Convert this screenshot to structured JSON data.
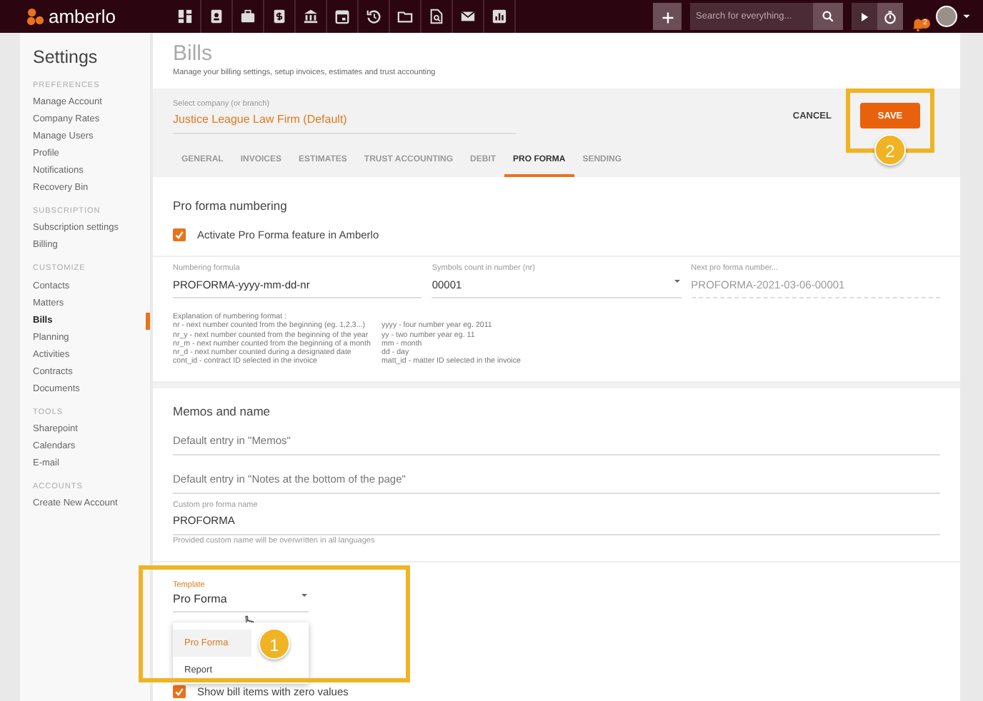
{
  "topbar": {
    "logo": "amberlo",
    "search": {
      "placeholder": "Search for everything..."
    },
    "notifications": "2"
  },
  "sidebar": {
    "title": "Settings",
    "sections": [
      {
        "heading": "PREFERENCES",
        "items": [
          {
            "label": "Manage Account",
            "selected": false
          },
          {
            "label": "Company Rates",
            "selected": false
          },
          {
            "label": "Manage Users",
            "selected": false
          },
          {
            "label": "Profile",
            "selected": false
          },
          {
            "label": "Notifications",
            "selected": false
          },
          {
            "label": "Recovery Bin",
            "selected": false
          }
        ]
      },
      {
        "heading": "SUBSCRIPTION",
        "items": [
          {
            "label": "Subscription settings",
            "selected": false
          },
          {
            "label": "Billing",
            "selected": false
          }
        ]
      },
      {
        "heading": "CUSTOMIZE",
        "items": [
          {
            "label": "Contacts",
            "selected": false
          },
          {
            "label": "Matters",
            "selected": false
          },
          {
            "label": "Bills",
            "selected": true
          },
          {
            "label": "Planning",
            "selected": false
          },
          {
            "label": "Activities",
            "selected": false
          },
          {
            "label": "Contracts",
            "selected": false
          },
          {
            "label": "Documents",
            "selected": false
          }
        ]
      },
      {
        "heading": "TOOLS",
        "items": [
          {
            "label": "Sharepoint",
            "selected": false
          },
          {
            "label": "Calendars",
            "selected": false
          },
          {
            "label": "E-mail",
            "selected": false
          }
        ]
      },
      {
        "heading": "ACCOUNTS",
        "items": [
          {
            "label": "Create New Account",
            "selected": false
          }
        ]
      }
    ]
  },
  "page": {
    "title": "Bills",
    "subtitle": "Manage your billing settings, setup invoices, estimates and trust accounting"
  },
  "company": {
    "label": "Select company (or branch)",
    "value": "Justice League Law Firm (Default)"
  },
  "actions": {
    "cancel": "CANCEL",
    "save": "SAVE"
  },
  "tabs": [
    {
      "label": "GENERAL",
      "selected": false
    },
    {
      "label": "INVOICES",
      "selected": false
    },
    {
      "label": "ESTIMATES",
      "selected": false
    },
    {
      "label": "TRUST ACCOUNTING",
      "selected": false
    },
    {
      "label": "DEBIT",
      "selected": false
    },
    {
      "label": "PRO FORMA",
      "selected": true
    },
    {
      "label": "SENDING",
      "selected": false
    }
  ],
  "numbering": {
    "title": "Pro forma numbering",
    "activate": {
      "label": "Activate Pro Forma feature in Amberlo",
      "checked": true
    },
    "fields": [
      {
        "kind": "text",
        "label": "Numbering formula",
        "value": "PROFORMA-yyyy-mm-dd-nr"
      },
      {
        "kind": "select",
        "label": "Symbols count in number (nr)",
        "value": "00001"
      },
      {
        "kind": "readonly",
        "label": "Next pro forma number...",
        "value": "PROFORMA-2021-03-06-00001"
      }
    ],
    "explanation": {
      "heading": "Explanation of numbering format :",
      "left": [
        "nr - next number counted from the beginning (eg. 1,2,3...)",
        "nr_y - next number counted from the beginning of the year",
        "nr_m - next number counted from the beginning of a month",
        "nr_d - next number counted during a designated date",
        "cont_id - contract ID selected in the invoice"
      ],
      "right": [
        "yyyy - four number year eg. 2011",
        "yy - two number year eg. 11",
        "mm - month",
        "dd - day",
        "matt_id - matter ID selected in the invoice"
      ]
    }
  },
  "memos": {
    "title": "Memos and name",
    "fields": [
      {
        "placeholder": "Default entry in \"Memos\""
      },
      {
        "placeholder": "Default entry in \"Notes at the bottom of the page\""
      }
    ],
    "custom_name": {
      "label": "Custom pro forma name",
      "value": "PROFORMA",
      "help": "Provided custom name will be overwritten in all languages"
    }
  },
  "template": {
    "label": "Template",
    "value": "Pro Forma",
    "options": [
      {
        "label": "Pro Forma",
        "selected": true
      },
      {
        "label": "Report",
        "selected": false
      }
    ]
  },
  "zero_values": {
    "label": "Show bill items with zero values",
    "checked": true
  },
  "callouts": [
    "1",
    "2"
  ]
}
